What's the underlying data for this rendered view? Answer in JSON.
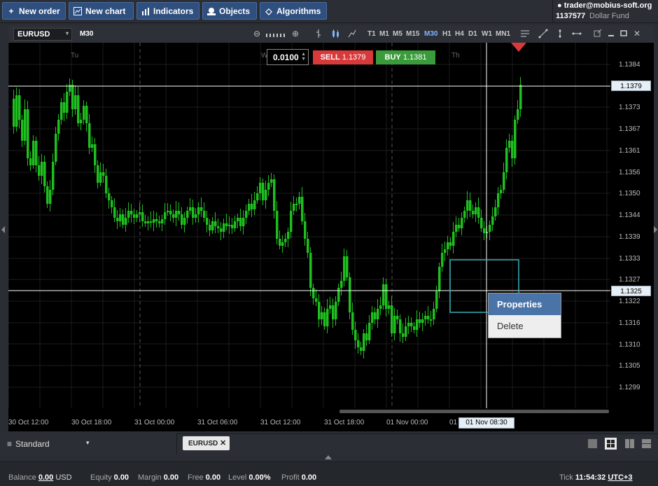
{
  "toolbar": {
    "new_order": "New order",
    "new_chart": "New chart",
    "indicators": "Indicators",
    "objects": "Objects",
    "algorithms": "Algorithms"
  },
  "account": {
    "user": "trader@mobius-soft.org",
    "number": "1137577",
    "fund": "Dollar Fund"
  },
  "chart": {
    "symbol": "EURUSD",
    "timeframe": "M30",
    "timeframes": [
      "T1",
      "M1",
      "M5",
      "M15",
      "M30",
      "H1",
      "H4",
      "D1",
      "W1",
      "MN1"
    ],
    "active_timeframe": "M30",
    "lot": "0.0100",
    "sell_label": "SELL",
    "sell_price": "1.1379",
    "buy_label": "BUY",
    "buy_price": "1.1381",
    "day_labels": [
      "Tu",
      "W",
      "Th"
    ],
    "price_labels": [
      "1.1384",
      "1.1373",
      "1.1367",
      "1.1361",
      "1.1356",
      "1.1350",
      "1.1344",
      "1.1339",
      "1.1333",
      "1.1327",
      "1.1322",
      "1.1316",
      "1.1310",
      "1.1305",
      "1.1299"
    ],
    "time_labels": [
      "30 Oct 12:00",
      "30 Oct 18:00",
      "31 Oct 00:00",
      "31 Oct 06:00",
      "31 Oct 12:00",
      "31 Oct 18:00",
      "01 Nov 00:00",
      "01"
    ],
    "crosshair_price_top": "1.1379",
    "crosshair_price_bottom": "1.1325",
    "crosshair_time": "01 Nov 08:30",
    "colors": {
      "bull": "#1fbf1f",
      "sell": "#d8393b",
      "buy": "#3a9b3a",
      "accent": "#4a73a8"
    }
  },
  "context_menu": {
    "properties": "Properties",
    "delete": "Delete"
  },
  "tabs": {
    "layout": "Standard",
    "chart_tab": "EURUSD"
  },
  "status": {
    "balance_label": "Balance",
    "balance_value": "0.00",
    "balance_currency": "USD",
    "equity_label": "Equity",
    "equity_value": "0.00",
    "margin_label": "Margin",
    "margin_value": "0.00",
    "free_label": "Free",
    "free_value": "0.00",
    "level_label": "Level",
    "level_value": "0.00%",
    "profit_label": "Profit",
    "profit_value": "0.00",
    "tick_label": "Tick",
    "time": "11:54:32",
    "tz": "UTC+3"
  }
}
